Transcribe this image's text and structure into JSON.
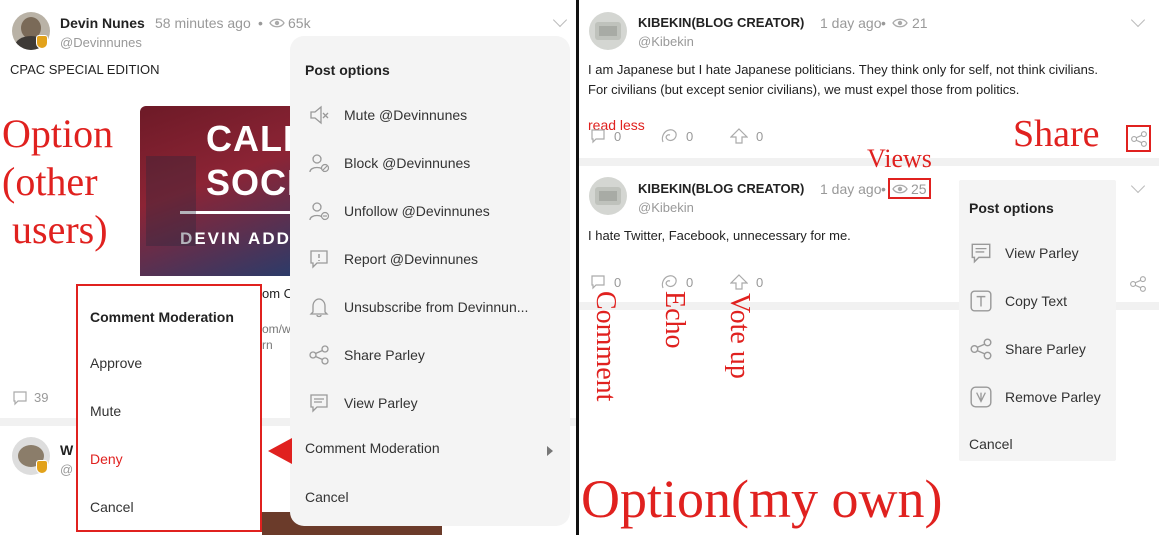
{
  "left": {
    "post1": {
      "author": "Devin Nunes",
      "time": "58 minutes ago",
      "dot": "•",
      "views": "65k",
      "handle": "@Devinnunes",
      "text": "CPAC SPECIAL EDITION",
      "image_lines": [
        "CALIF",
        "SOCIA",
        "DEVIN ADDR"
      ],
      "link_fragments": [
        "om C",
        "om/w",
        "rn"
      ],
      "comment_count": "39"
    },
    "post2": {
      "author_fragment": "W",
      "handle_fragment": "@"
    },
    "post_options": {
      "title": "Post options",
      "items": [
        "Mute @Devinnunes",
        "Block @Devinnunes",
        "Unfollow @Devinnunes",
        "Report @Devinnunes",
        "Unsubscribe from Devinnun...",
        "Share Parley",
        "View Parley",
        "Comment Moderation"
      ],
      "cancel": "Cancel"
    },
    "comment_moderation": {
      "title": "Comment Moderation",
      "approve": "Approve",
      "mute": "Mute",
      "deny": "Deny",
      "cancel": "Cancel"
    }
  },
  "right": {
    "post1": {
      "author": "KIBEKIN(BLOG CREATOR)",
      "time": "1 day ago",
      "dot": "•",
      "views": "21",
      "handle": "@Kibekin",
      "line1": "I am Japanese but I hate Japanese politicians. They think only for self, not think civilians.",
      "line2": "For civilians (but except senior civilians), we must expel those from politics.",
      "read_less": "read less",
      "comments": "0",
      "echoes": "0",
      "votes": "0"
    },
    "post2": {
      "author": "KIBEKIN(BLOG CREATOR)",
      "time": "1 day ago",
      "dot": "•",
      "views": "25",
      "handle": "@Kibekin",
      "text": "I hate Twitter, Facebook, unnecessary for me.",
      "comments": "0",
      "echoes": "0",
      "votes": "0"
    },
    "post_options": {
      "title": "Post options",
      "items": [
        "View Parley",
        "Copy Text",
        "Share Parley",
        "Remove Parley"
      ],
      "cancel": "Cancel"
    }
  },
  "annotations": {
    "option_other_lines": [
      "Option",
      "(other",
      "users)"
    ],
    "share": "Share",
    "views": "Views",
    "comment": "Comment",
    "echo": "Echo",
    "vote_up": "Vote up",
    "option_own": "Option(my own)"
  },
  "colors": {
    "annotation_red": "#e0211f",
    "deny_red": "#e0211f",
    "menu_bg": "#f4f4f4",
    "muted_gray": "#999999",
    "badge_gold": "#e2a21b"
  },
  "icons": {
    "views": "eye-icon",
    "comment": "speech-bubble-icon",
    "echo": "echo-icon",
    "vote": "arrow-up-icon",
    "share": "share-icon",
    "expand": "chevron-down-icon"
  }
}
